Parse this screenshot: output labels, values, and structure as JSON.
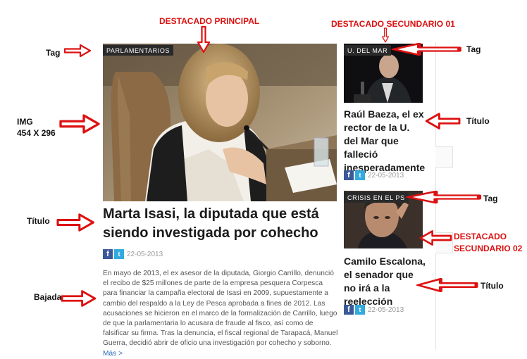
{
  "main": {
    "tag": "PARLAMENTARIOS",
    "title": "Marta Isasi, la diputada que está siendo investigada por cohecho",
    "date": "22-05-2013",
    "body": "En mayo de 2013, el ex asesor de la diputada, Giorgio Carrillo, denunció el recibo de $25 millones de parte de la empresa pesquera Corpesca para financiar la campaña electoral de Isasi en 2009, supuestamente a cambio del respaldo a la Ley de Pesca aprobada a fines de 2012. Las acusaciones se hicieron en el marco de la formalización de Carrillo, luego de que la parlamentaria lo acusara de fraude al fisco, así como de falsificar su firma. Tras la denuncia, el fiscal regional de Tarapacá, Manuel Guerra, decidió abrir de oficio una investigación por cohecho y soborno.",
    "more_label": "Más >"
  },
  "secondary_1": {
    "tag": "U. DEL MAR",
    "title": "Raúl Baeza, el ex rector de la U. del Mar que falleció inesperadamente",
    "date": "22-05-2013"
  },
  "secondary_2": {
    "tag": "CRISIS EN EL PS",
    "title": "Camilo Escalona, el senador que no irá a la reelección",
    "date": "22-05-2013"
  },
  "annotations": {
    "destacado_principal": "DESTACADO PRINCIPAL",
    "destacado_secundario_01": "DESTACADO SECUNDARIO 01",
    "destacado_secundario_02_line1": "DESTACADO",
    "destacado_secundario_02_line2": "SECUNDARIO 02",
    "tag": "Tag",
    "img_line1": "IMG",
    "img_line2": "454 X 296",
    "titulo": "Título",
    "bajada": "Bajada"
  },
  "icons": {
    "facebook": "facebook-icon",
    "twitter": "twitter-icon",
    "arrow": "red-arrow-icon"
  },
  "colors": {
    "annotation_red": "#dd1111",
    "tag_bg": "#2a2a2a",
    "facebook": "#3b5998",
    "twitter": "#33aadd",
    "link": "#2d6db5"
  }
}
